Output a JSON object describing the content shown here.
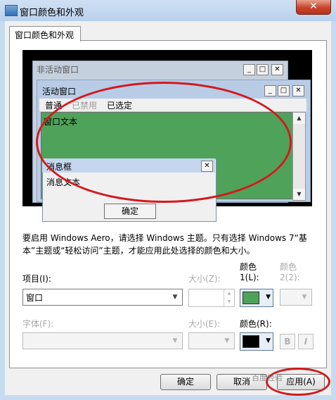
{
  "window": {
    "title": "窗口颜色和外观",
    "close_glyph": "✕"
  },
  "tab": {
    "label": "窗口颜色和外观"
  },
  "preview": {
    "inactive_title": "非活动窗口",
    "active_title": "活动窗口",
    "menu": [
      "普通",
      "已禁用",
      "已选定"
    ],
    "window_text": "窗口文本",
    "msgbox_title": "消息框",
    "msgbox_text": "消息文本",
    "msgbox_ok": "确定",
    "min_glyph": "_",
    "max_glyph": "□",
    "close_glyph": "✕",
    "scroll_up": "▲",
    "scroll_down": "▼"
  },
  "info_text": "要启用 Windows Aero，请选择 Windows 主题。只有选择 Windows 7“基本”主题或“轻松访问”主题，才能应用此处选择的颜色和大小。",
  "item": {
    "label": "项目(I):",
    "value": "窗口"
  },
  "item_size": {
    "label": "大小(Z):"
  },
  "color1": {
    "label_line1": "颜色",
    "label_line2": "1(L):",
    "swatch": "#4fa25a"
  },
  "color2": {
    "label_line1": "颜色",
    "label_line2": "2(2):"
  },
  "font": {
    "label": "字体(F):"
  },
  "font_size": {
    "label": "大小(E):"
  },
  "font_color": {
    "label": "颜色(R):",
    "swatch": "#000000"
  },
  "bold_label": "B",
  "italic_label": "I",
  "buttons": {
    "ok": "确定",
    "cancel": "取消",
    "apply": "应用(A)"
  },
  "watermark": "百度经验",
  "colors": {
    "accent_red": "#d4191c",
    "title_bar": "#c7dbf0"
  }
}
